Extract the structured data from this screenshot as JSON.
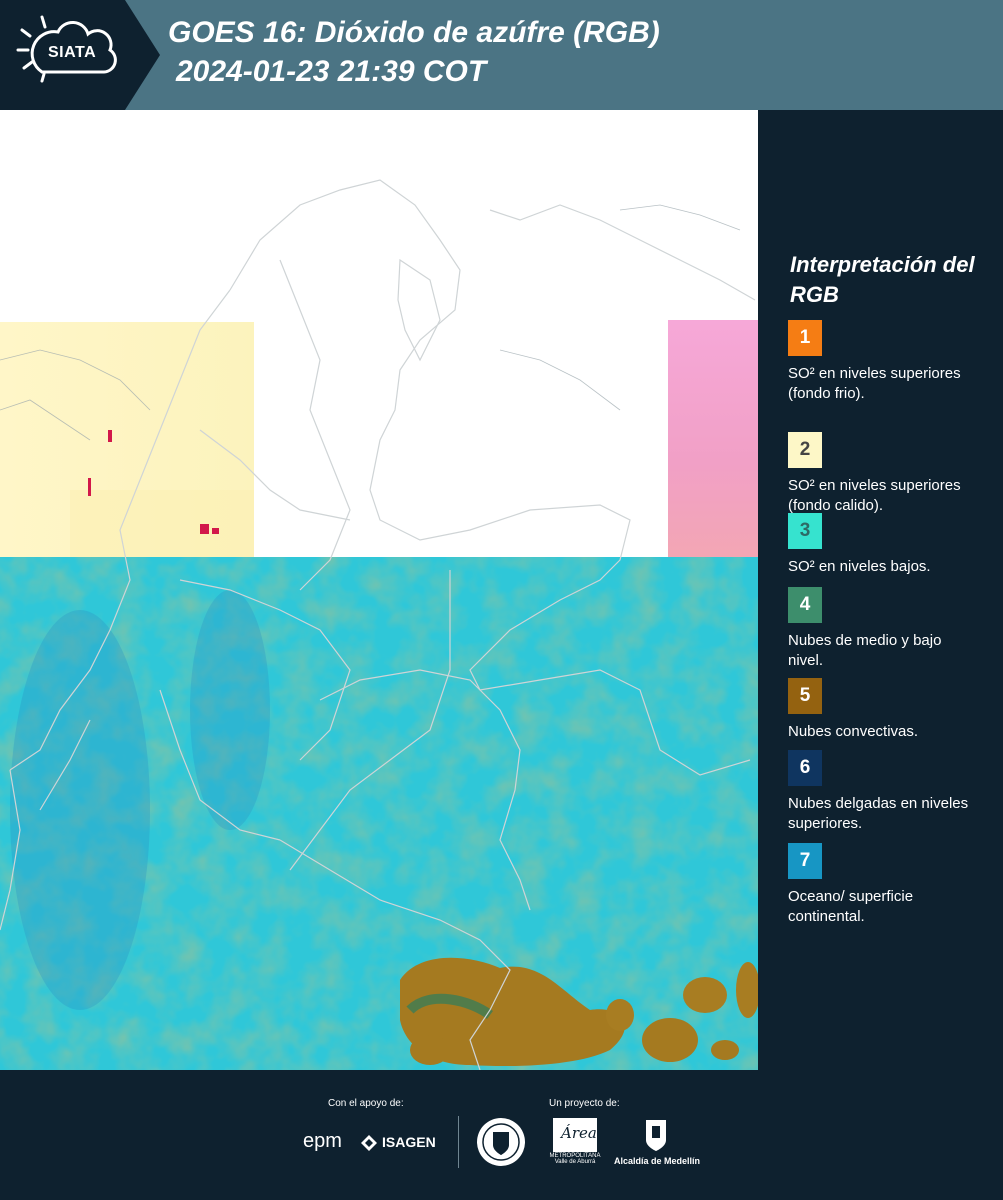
{
  "header": {
    "logo_text": "SIATA",
    "title_line1": "GOES 16: Dióxido de azúfre (RGB)",
    "title_line2": "2024-01-23 21:39 COT"
  },
  "map": {
    "icon": "satellite-rgb-composite",
    "colors": {
      "ocean_surface": "#2ec6d6",
      "cloud_green": "#4a9c78",
      "convective": "#a87b1c",
      "so2_warm": "#fff6c6",
      "pink_band": "#f2a4cf",
      "nodata": "#ffffff"
    }
  },
  "legend": {
    "title": "Interpretación del RGB",
    "items": [
      {
        "number": "1",
        "label": "SO² en niveles superiores (fondo frio).",
        "color": "#f57d14",
        "text_color": "#ffffff"
      },
      {
        "number": "2",
        "label": "SO² en niveles superiores (fondo calido).",
        "color": "#fdf7c7",
        "text_color": "#444444"
      },
      {
        "number": "3",
        "label": "SO² en niveles bajos.",
        "color": "#36e3cf",
        "text_color": "#2d6b66"
      },
      {
        "number": "4",
        "label": "Nubes de medio y bajo nivel.",
        "color": "#3d8e6c",
        "text_color": "#ffffff"
      },
      {
        "number": "5",
        "label": "Nubes convectivas.",
        "color": "#946210",
        "text_color": "#ffffff"
      },
      {
        "number": "6",
        "label": "Nubes delgadas en niveles superiores.",
        "color": "#0f3560",
        "text_color": "#ffffff"
      },
      {
        "number": "7",
        "label": "Oceano/ superficie continental.",
        "color": "#1796c4",
        "text_color": "#ffffff"
      }
    ]
  },
  "footer": {
    "support_label": "Con el apoyo de:",
    "project_label": "Un proyecto de:",
    "sponsor1": "epm",
    "sponsor2": "ISAGEN",
    "partner1": "METROPOLITANA Valle de Aburrá",
    "partner1_script": "Área",
    "partner2": "Alcaldía de Medellín"
  }
}
